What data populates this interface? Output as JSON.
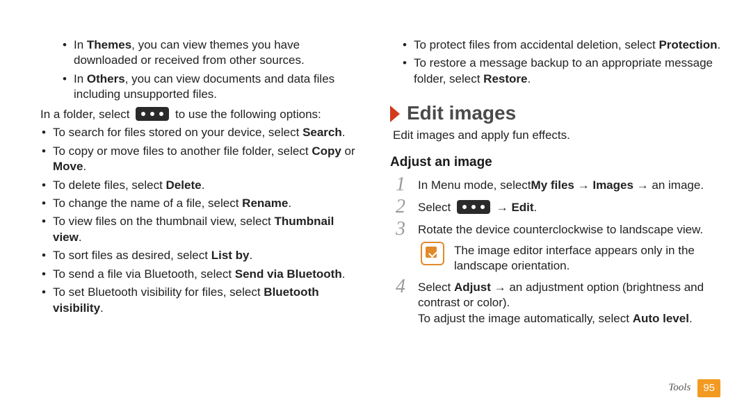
{
  "left": {
    "themes_line": [
      "In ",
      "Themes",
      ", you can view themes you have downloaded or received from other sources."
    ],
    "others_line": [
      "In ",
      "Others",
      ", you can view documents and data files including unsupported files."
    ],
    "folder_pre": "In a folder, select ",
    "folder_post": " to use the following options:",
    "opts": [
      [
        "To search for files stored on your device, select ",
        "Search",
        "."
      ],
      [
        "To copy or move files to another file folder, select ",
        "Copy",
        " or ",
        "Move",
        "."
      ],
      [
        "To delete files, select ",
        "Delete",
        "."
      ],
      [
        "To change the name of a file, select ",
        "Rename",
        "."
      ],
      [
        "To view files on the thumbnail view, select ",
        "Thumbnail view",
        "."
      ],
      [
        "To sort files as desired, select ",
        "List by",
        "."
      ],
      [
        "To send a file via Bluetooth, select ",
        "Send via Bluetooth",
        "."
      ],
      [
        "To set Bluetooth visibility for files, select ",
        "Bluetooth visibility",
        "."
      ]
    ]
  },
  "right": {
    "top_opts": [
      [
        "To protect files from accidental deletion, select ",
        "Protection",
        "."
      ],
      [
        "To restore a message backup to an appropriate message folder, select ",
        "Restore",
        "."
      ]
    ],
    "heading": "Edit images",
    "heading_sub": "Edit images and apply fun effects.",
    "sub_heading": "Adjust an image",
    "step1": [
      "In Menu mode, select",
      "My files",
      " → ",
      "Images",
      " → an image."
    ],
    "step2_pre": "Select ",
    "step2_arrow": " → ",
    "step2_edit": "Edit",
    "step2_post": ".",
    "step3": "Rotate the device counterclockwise to landscape view.",
    "note": "The image editor interface appears only in the landscape orientation.",
    "step4": [
      "Select ",
      "Adjust",
      " → an adjustment option (brightness and contrast or color)."
    ],
    "step4b": [
      "To adjust the image automatically, select ",
      "Auto level",
      "."
    ]
  },
  "footer": {
    "section": "Tools",
    "page": "95"
  }
}
